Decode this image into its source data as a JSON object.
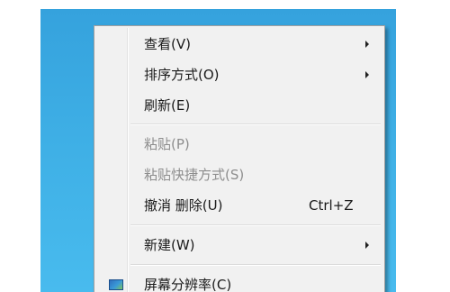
{
  "context_menu": {
    "items": [
      {
        "label": "查看(V)",
        "submenu": true
      },
      {
        "label": "排序方式(O)",
        "submenu": true
      },
      {
        "label": "刷新(E)"
      },
      {
        "label": "粘贴(P)",
        "disabled": true
      },
      {
        "label": "粘贴快捷方式(S)",
        "disabled": true
      },
      {
        "label": "撤消 删除(U)",
        "shortcut": "Ctrl+Z"
      },
      {
        "label": "新建(W)",
        "submenu": true
      },
      {
        "label": "屏幕分辨率(C)",
        "icon": "screen-resolution-icon"
      }
    ]
  },
  "colors": {
    "desktop_top": "#35a2dd",
    "desktop_bottom": "#48bbee",
    "menu_background": "#f1f1f1",
    "disabled_text": "#8d8d8d"
  }
}
